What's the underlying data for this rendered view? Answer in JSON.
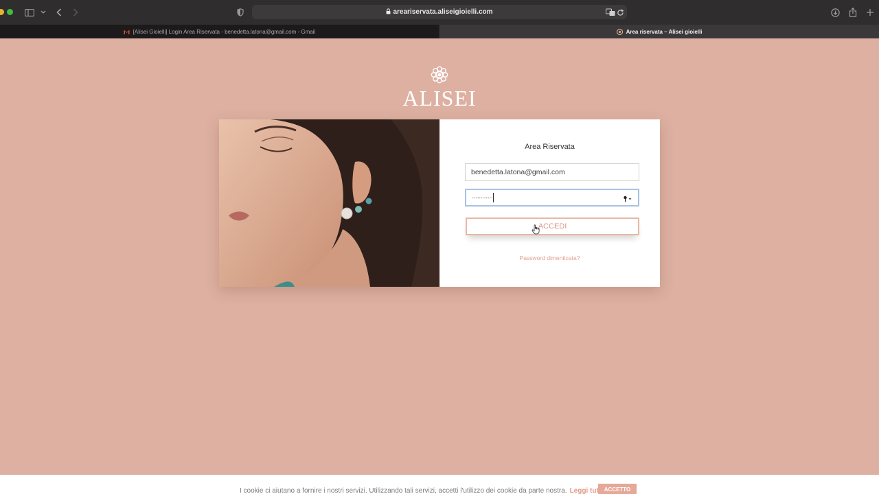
{
  "browser": {
    "url": "areariservata.aliseigioielli.com",
    "tabs": [
      {
        "label": "[Alisei Gioielli] Login Area Riservata - benedetta.latona@gmail.com - Gmail",
        "active": false
      },
      {
        "label": "Area riservata – Alisei gioielli",
        "active": true
      }
    ]
  },
  "page": {
    "logo_text": "ALISEI",
    "form": {
      "title": "Area Riservata",
      "email_value": "benedetta.latona@gmail.com",
      "password_mask": "············",
      "submit_label": "ACCEDI",
      "forgot_label": "Password dimenticata?"
    }
  },
  "cookie": {
    "text": "I cookie ci aiutano a fornire i nostri servizi. Utilizzando tali servizi, accetti l'utilizzo dei cookie da parte nostra.",
    "link_label": "Leggi tutto",
    "accept_label": "ACCETTO"
  },
  "colors": {
    "page_bg": "#ddb0a1",
    "accent": "#e29a87",
    "chrome_bg": "#2f2d2e"
  }
}
